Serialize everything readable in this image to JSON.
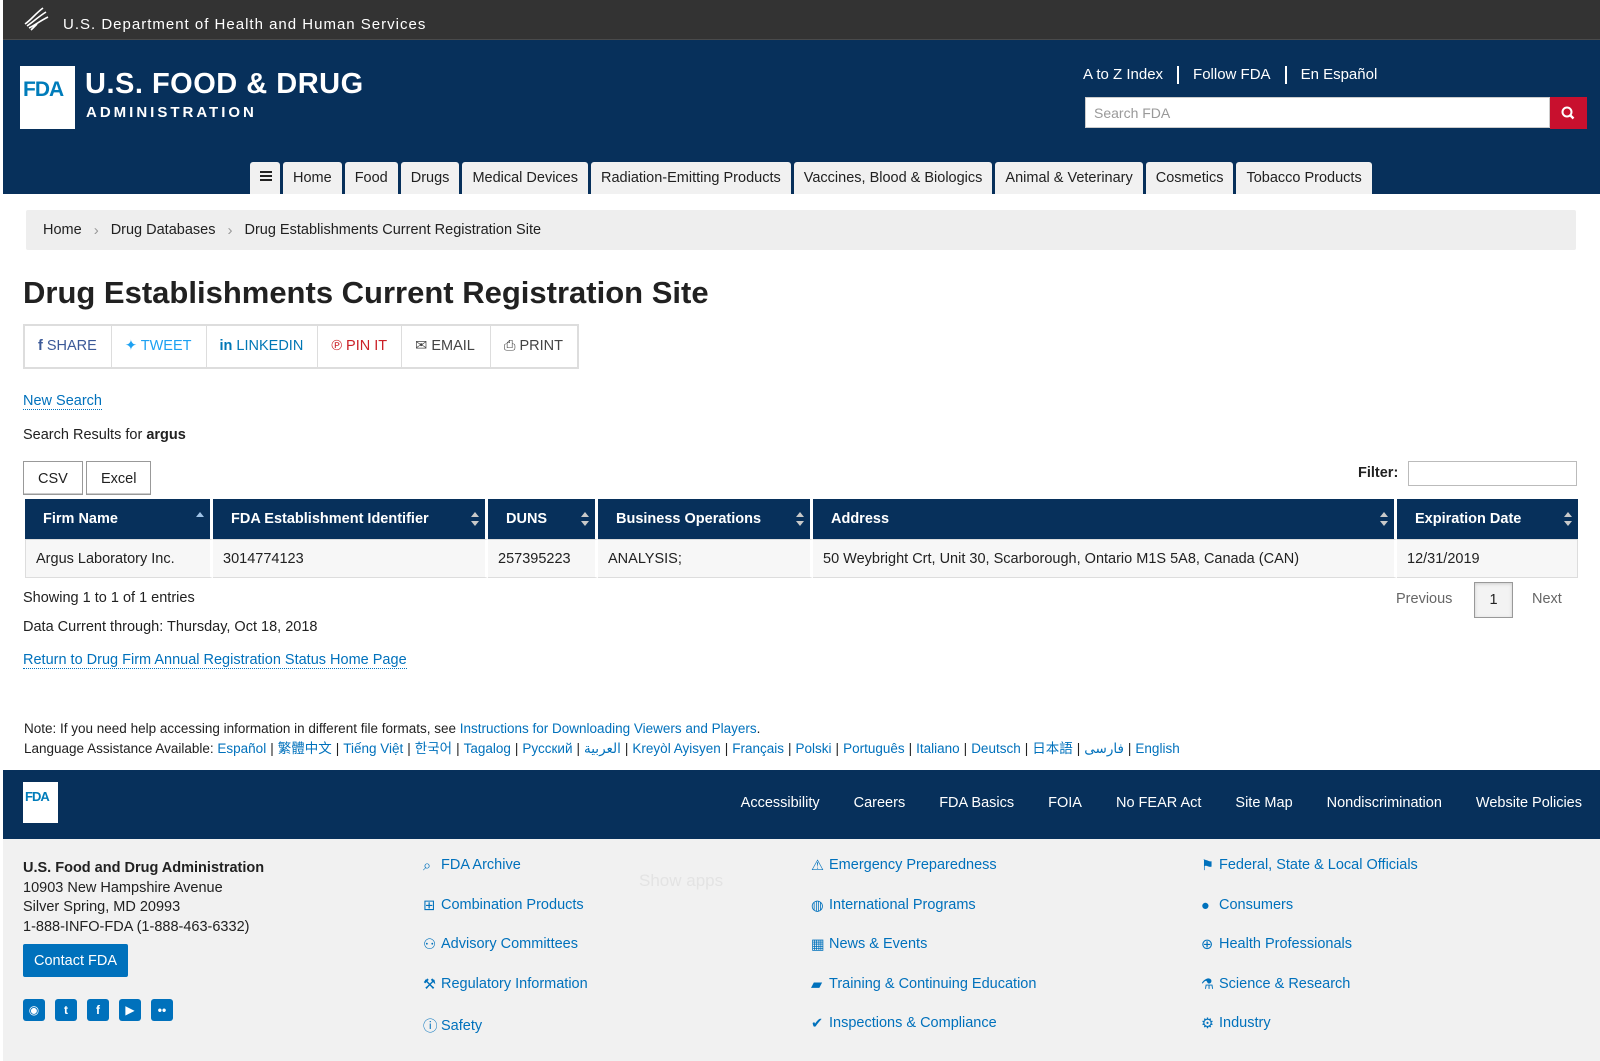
{
  "hhs": {
    "text": "U.S. Department of Health and Human Services"
  },
  "header": {
    "logo_mark": "FDA",
    "title": "U.S. FOOD & DRUG",
    "subtitle": "ADMINISTRATION",
    "util_links": [
      "A to Z Index",
      "Follow FDA",
      "En Español"
    ],
    "search_placeholder": "Search FDA",
    "nav": [
      "Home",
      "Food",
      "Drugs",
      "Medical Devices",
      "Radiation-Emitting Products",
      "Vaccines, Blood & Biologics",
      "Animal & Veterinary",
      "Cosmetics",
      "Tobacco Products"
    ]
  },
  "breadcrumb": [
    "Home",
    "Drug Databases",
    "Drug Establishments Current Registration Site"
  ],
  "page_title": "Drug Establishments Current Registration Site",
  "share": {
    "share": "SHARE",
    "tweet": "TWEET",
    "linkedin": "LINKEDIN",
    "pin": "PIN IT",
    "email": "EMAIL",
    "print": "PRINT"
  },
  "new_search": "New Search",
  "results": {
    "prefix": "Search Results for ",
    "term": "argus"
  },
  "buttons": {
    "csv": "CSV",
    "excel": "Excel"
  },
  "filter_label": "Filter:",
  "table": {
    "headers": [
      "Firm Name",
      "FDA Establishment Identifier",
      "DUNS",
      "Business Operations",
      "Address",
      "Expiration Date"
    ],
    "rows": [
      [
        "Argus Laboratory Inc.",
        "3014774123",
        "257395223",
        "ANALYSIS;",
        "50 Weybright Crt, Unit 30, Scarborough, Ontario M1S 5A8, Canada (CAN)",
        "12/31/2019"
      ]
    ]
  },
  "showing": "Showing 1 to 1 of 1 entries",
  "pager": {
    "prev": "Previous",
    "page": "1",
    "next": "Next"
  },
  "data_current": "Data Current through: Thursday, Oct 18, 2018",
  "return_link": "Return to Drug Firm Annual Registration Status Home Page",
  "note": {
    "prefix": "Note: If you need help accessing information in different file formats, see ",
    "link": "Instructions for Downloading Viewers and Players",
    "suffix": "."
  },
  "lang": {
    "prefix": "Language Assistance Available: ",
    "items": [
      "Español",
      "繁體中文",
      "Tiếng Việt",
      "한국어",
      "Tagalog",
      "Русский",
      "العربية",
      "Kreyòl Ayisyen",
      "Français",
      "Polski",
      "Português",
      "Italiano",
      "Deutsch",
      "日本語",
      "فارسی",
      "English"
    ]
  },
  "footer": {
    "logo_mark": "FDA",
    "links": [
      "Accessibility",
      "Careers",
      "FDA Basics",
      "FOIA",
      "No FEAR Act",
      "Site Map",
      "Nondiscrimination",
      "Website Policies"
    ],
    "address": {
      "name": "U.S. Food and Drug Administration",
      "line1": "10903 New Hampshire Avenue",
      "line2": "Silver Spring, MD 20993",
      "phone": "1-888-INFO-FDA (1-888-463-6332)"
    },
    "contact": "Contact FDA",
    "col1": [
      "FDA Archive",
      "Combination Products",
      "Advisory Committees",
      "Regulatory Information",
      "Safety"
    ],
    "col2": [
      "Emergency Preparedness",
      "International Programs",
      "News & Events",
      "Training & Continuing Education",
      "Inspections & Compliance"
    ],
    "col3": [
      "Federal, State & Local Officials",
      "Consumers",
      "Health Professionals",
      "Science & Research",
      "Industry"
    ],
    "show_apps": "Show apps"
  },
  "colors": {
    "navy": "#07305b",
    "link": "#0071bc",
    "search_red": "#c8102e"
  }
}
